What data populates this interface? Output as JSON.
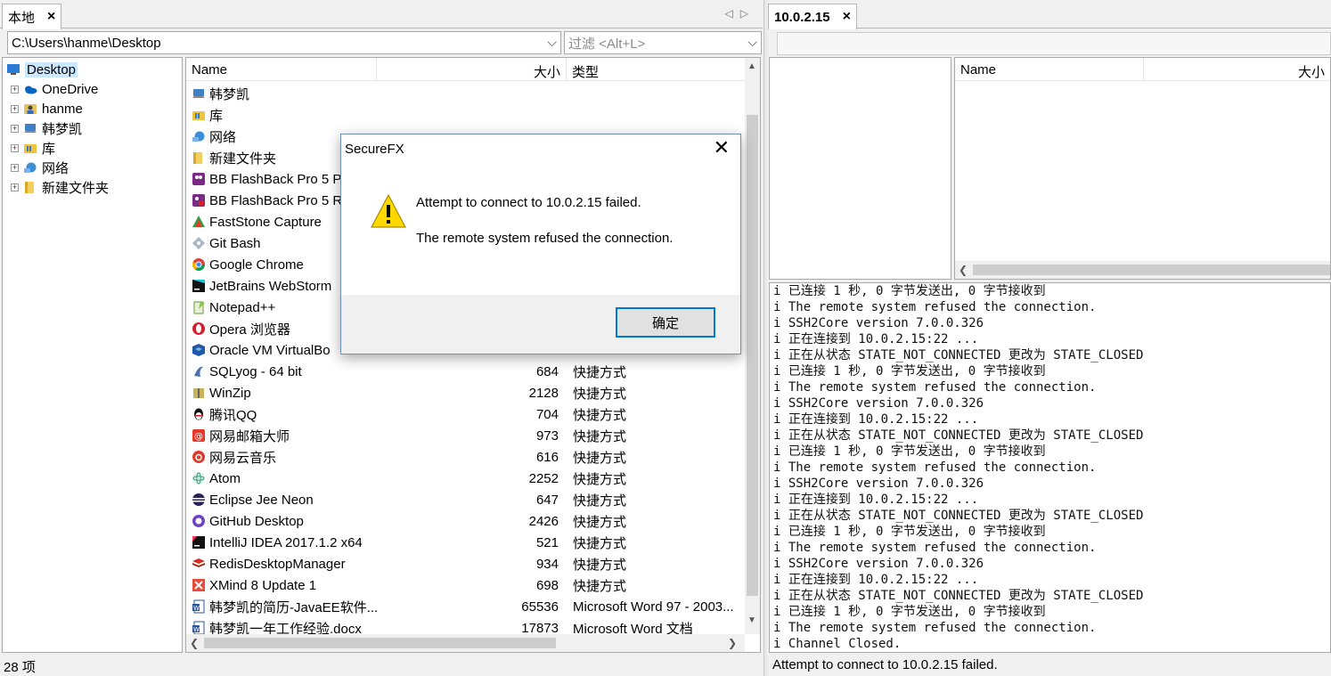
{
  "left": {
    "tab_label": "本地",
    "path": "C:\\Users\\hanme\\Desktop",
    "filter_placeholder": "过滤 <Alt+L>",
    "tree": [
      {
        "label": "Desktop",
        "icon": "desktop-icon",
        "selected": true
      },
      {
        "label": "OneDrive",
        "icon": "onedrive-icon"
      },
      {
        "label": "hanme",
        "icon": "user-folder-icon"
      },
      {
        "label": "韩梦凯",
        "icon": "computer-icon"
      },
      {
        "label": "库",
        "icon": "library-icon"
      },
      {
        "label": "网络",
        "icon": "network-icon"
      },
      {
        "label": "新建文件夹",
        "icon": "folder-icon"
      }
    ],
    "columns": {
      "name": "Name",
      "size": "大小",
      "type": "类型"
    },
    "files": [
      {
        "name": "韩梦凯",
        "size": "",
        "type": "",
        "icon": "computer-icon"
      },
      {
        "name": "库",
        "size": "",
        "type": "",
        "icon": "library-icon"
      },
      {
        "name": "网络",
        "size": "",
        "type": "",
        "icon": "network-icon"
      },
      {
        "name": "新建文件夹",
        "size": "",
        "type": "",
        "icon": "folder-icon"
      },
      {
        "name": "BB FlashBack Pro 5 P",
        "size": "",
        "type": "",
        "icon": "bbflashback-icon"
      },
      {
        "name": "BB FlashBack Pro 5 R",
        "size": "",
        "type": "",
        "icon": "bbflashback-recorder-icon"
      },
      {
        "name": "FastStone Capture",
        "size": "",
        "type": "",
        "icon": "faststone-icon"
      },
      {
        "name": "Git Bash",
        "size": "",
        "type": "",
        "icon": "git-icon"
      },
      {
        "name": "Google Chrome",
        "size": "",
        "type": "",
        "icon": "chrome-icon"
      },
      {
        "name": "JetBrains WebStorm",
        "size": "",
        "type": "",
        "icon": "webstorm-icon"
      },
      {
        "name": "Notepad++",
        "size": "",
        "type": "",
        "icon": "notepadpp-icon"
      },
      {
        "name": "Opera 浏览器",
        "size": "",
        "type": "",
        "icon": "opera-icon"
      },
      {
        "name": "Oracle VM VirtualBo",
        "size": "",
        "type": "",
        "icon": "virtualbox-icon"
      },
      {
        "name": "SQLyog - 64 bit",
        "size": "684",
        "type": "快捷方式",
        "icon": "sqlyog-icon"
      },
      {
        "name": "WinZip",
        "size": "2128",
        "type": "快捷方式",
        "icon": "winzip-icon"
      },
      {
        "name": "腾讯QQ",
        "size": "704",
        "type": "快捷方式",
        "icon": "qq-icon"
      },
      {
        "name": "网易邮箱大师",
        "size": "973",
        "type": "快捷方式",
        "icon": "mail-master-icon"
      },
      {
        "name": "网易云音乐",
        "size": "616",
        "type": "快捷方式",
        "icon": "cloud-music-icon"
      },
      {
        "name": "Atom",
        "size": "2252",
        "type": "快捷方式",
        "icon": "atom-icon"
      },
      {
        "name": "Eclipse Jee Neon",
        "size": "647",
        "type": "快捷方式",
        "icon": "eclipse-icon"
      },
      {
        "name": "GitHub Desktop",
        "size": "2426",
        "type": "快捷方式",
        "icon": "github-desktop-icon"
      },
      {
        "name": "IntelliJ IDEA 2017.1.2 x64",
        "size": "521",
        "type": "快捷方式",
        "icon": "intellij-icon"
      },
      {
        "name": "RedisDesktopManager",
        "size": "934",
        "type": "快捷方式",
        "icon": "redis-icon"
      },
      {
        "name": "XMind 8 Update 1",
        "size": "698",
        "type": "快捷方式",
        "icon": "xmind-icon"
      },
      {
        "name": "韩梦凯的简历-JavaEE软件...",
        "size": "65536",
        "type": "Microsoft Word 97 - 2003...",
        "icon": "word-doc-icon"
      },
      {
        "name": "韩梦凯一年工作经验.docx",
        "size": "17873",
        "type": "Microsoft Word 文档",
        "icon": "word-docx-icon"
      }
    ],
    "status": "28 项"
  },
  "right": {
    "tab_label": "10.0.2.15",
    "columns": {
      "name": "Name",
      "size": "大小"
    },
    "log": [
      "i 已连接 1 秒, 0 字节发送出, 0 字节接收到",
      "i The remote system refused the connection.",
      "i SSH2Core version 7.0.0.326",
      "i 正在连接到 10.0.2.15:22 ...",
      "i 正在从状态 STATE_NOT_CONNECTED 更改为 STATE_CLOSED",
      "i 已连接 1 秒, 0 字节发送出, 0 字节接收到",
      "i The remote system refused the connection.",
      "i SSH2Core version 7.0.0.326",
      "i 正在连接到 10.0.2.15:22 ...",
      "i 正在从状态 STATE_NOT_CONNECTED 更改为 STATE_CLOSED",
      "i 已连接 1 秒, 0 字节发送出, 0 字节接收到",
      "i The remote system refused the connection.",
      "i SSH2Core version 7.0.0.326",
      "i 正在连接到 10.0.2.15:22 ...",
      "i 正在从状态 STATE_NOT_CONNECTED 更改为 STATE_CLOSED",
      "i 已连接 1 秒, 0 字节发送出, 0 字节接收到",
      "i The remote system refused the connection.",
      "i SSH2Core version 7.0.0.326",
      "i 正在连接到 10.0.2.15:22 ...",
      "i 正在从状态 STATE_NOT_CONNECTED 更改为 STATE_CLOSED",
      "i 已连接 1 秒, 0 字节发送出, 0 字节接收到",
      "i The remote system refused the connection.",
      "i Channel Closed."
    ],
    "status": "Attempt to connect to 10.0.2.15 failed."
  },
  "dialog": {
    "title": "SecureFX",
    "message1": "Attempt to connect to 10.0.2.15 failed.",
    "message2": "The remote system refused the connection.",
    "ok_label": "确定",
    "icon": "warning-icon"
  }
}
